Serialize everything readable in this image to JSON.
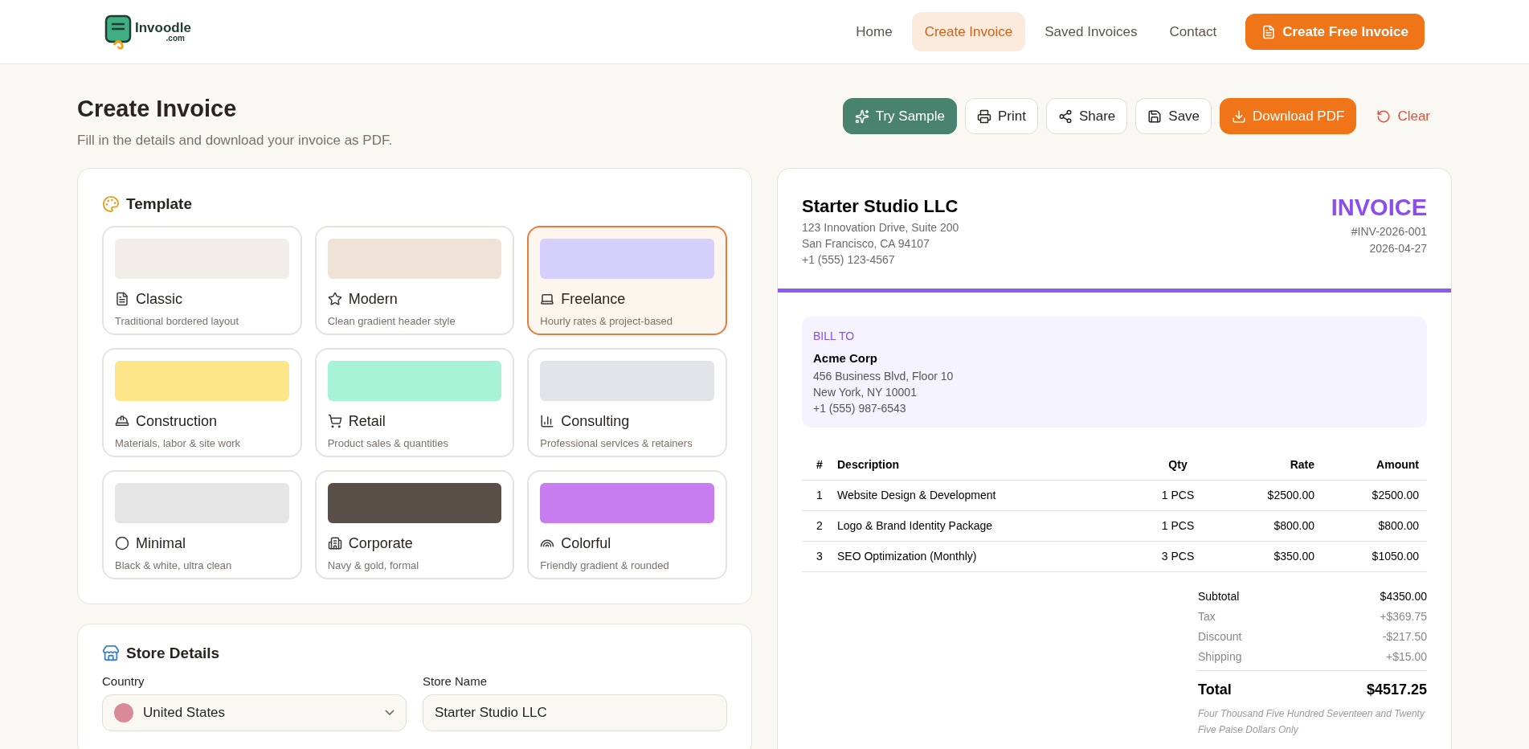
{
  "brand": {
    "name": "Invoodle",
    "suffix": ".com"
  },
  "nav": [
    {
      "label": "Home",
      "selected": false
    },
    {
      "label": "Create Invoice",
      "selected": true
    },
    {
      "label": "Saved Invoices",
      "selected": false
    },
    {
      "label": "Contact",
      "selected": false
    }
  ],
  "cta": "Create Free Invoice",
  "page": {
    "title": "Create Invoice",
    "subtitle": "Fill in the details and download your invoice as PDF."
  },
  "actions": [
    {
      "label": "Try Sample",
      "kind": "sample"
    },
    {
      "label": "Print",
      "kind": "print"
    },
    {
      "label": "Share",
      "kind": "share"
    },
    {
      "label": "Save",
      "kind": "save"
    },
    {
      "label": "Download PDF",
      "kind": "download"
    },
    {
      "label": "Clear",
      "kind": "clear"
    }
  ],
  "template": {
    "title": "Template",
    "items": [
      {
        "name": "Classic",
        "desc": "Traditional bordered layout",
        "color": "#f1eeea",
        "selected": false
      },
      {
        "name": "Modern",
        "desc": "Clean gradient header style",
        "color": "#efe2d6",
        "selected": false
      },
      {
        "name": "Freelance",
        "desc": "Hourly rates & project-based",
        "color": "#d4d0fb",
        "selected": true
      },
      {
        "name": "Construction",
        "desc": "Materials, labor & site work",
        "color": "#fde68a",
        "selected": false
      },
      {
        "name": "Retail",
        "desc": "Product sales & quantities",
        "color": "#a7f3d8",
        "selected": false
      },
      {
        "name": "Consulting",
        "desc": "Professional services & retainers",
        "color": "#e2e4e9",
        "selected": false
      },
      {
        "name": "Minimal",
        "desc": "Black & white, ultra clean",
        "color": "#e5e5e5",
        "selected": false
      },
      {
        "name": "Corporate",
        "desc": "Navy & gold, formal",
        "color": "#5a4e48",
        "selected": false
      },
      {
        "name": "Colorful",
        "desc": "Friendly gradient & rounded",
        "color": "#c77df0",
        "selected": false
      }
    ]
  },
  "store": {
    "title": "Store Details",
    "fields": [
      {
        "label": "Country",
        "value": "United States",
        "kind": "select"
      },
      {
        "label": "Store Name",
        "value": "Starter Studio LLC",
        "kind": "text"
      }
    ]
  },
  "invoice": {
    "company": "Starter Studio LLC",
    "address": [
      "123 Innovation Drive, Suite 200",
      "San Francisco, CA 94107",
      "+1 (555) 123-4567"
    ],
    "heading": "INVOICE",
    "number": "#INV-2026-001",
    "date": "2026-04-27",
    "bill_to": {
      "label": "BILL TO",
      "name": "Acme Corp",
      "lines": [
        "456 Business Blvd, Floor 10",
        "New York, NY 10001",
        "+1 (555) 987-6543"
      ]
    },
    "columns": [
      "#",
      "Description",
      "Qty",
      "Rate",
      "Amount"
    ],
    "rows": [
      [
        "1",
        "Website Design & Development",
        "1 PCS",
        "$2500.00",
        "$2500.00"
      ],
      [
        "2",
        "Logo & Brand Identity Package",
        "1 PCS",
        "$800.00",
        "$800.00"
      ],
      [
        "3",
        "SEO Optimization (Monthly)",
        "3 PCS",
        "$350.00",
        "$1050.00"
      ]
    ],
    "totals": [
      {
        "label": "Subtotal",
        "value": "$4350.00",
        "kind": "main"
      },
      {
        "label": "Tax",
        "value": "+$369.75",
        "kind": "minor"
      },
      {
        "label": "Discount",
        "value": "-$217.50",
        "kind": "minor"
      },
      {
        "label": "Shipping",
        "value": "+$15.00",
        "kind": "minor"
      }
    ],
    "total": {
      "label": "Total",
      "value": "$4517.25"
    },
    "in_words": "Four Thousand Five Hundred Seventeen and Twenty Five Paise Dollars Only"
  }
}
